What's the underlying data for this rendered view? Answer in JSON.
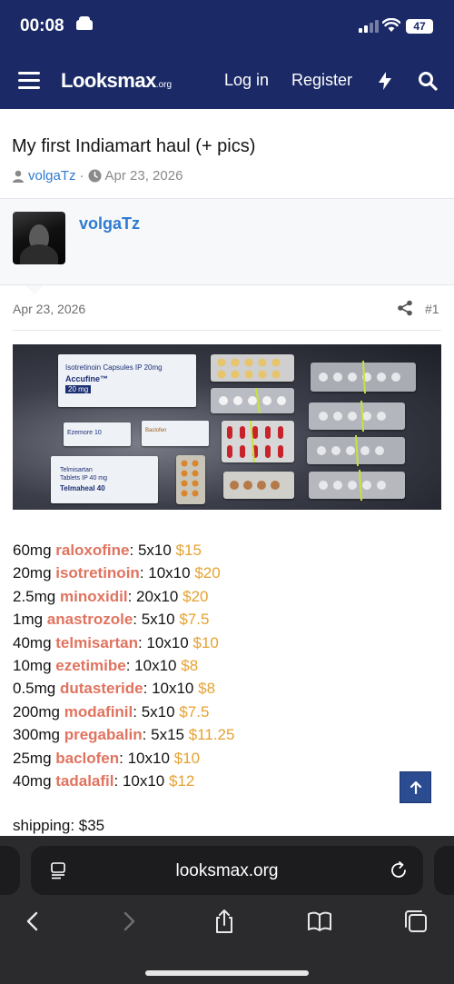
{
  "status_bar": {
    "time": "00:08",
    "battery": "47"
  },
  "navbar": {
    "logo_main": "Looksmax",
    "logo_suffix": ".org",
    "login_label": "Log in",
    "register_label": "Register"
  },
  "thread": {
    "title": "My first Indiamart haul (+ pics)",
    "author": "volgaTz",
    "separator": "·",
    "date": "Apr 23, 2026"
  },
  "post": {
    "author": "volgaTz",
    "date": "Apr 23, 2026",
    "number": "#1",
    "photo_labels": {
      "box1_line1": "Isotretinoin Capsules IP 20mg",
      "box1_line2": "Accufine™",
      "box1_line3": "20 mg",
      "box2": "Telmisartan",
      "box2_line2": "Tablets IP 40 mg",
      "box2_line3": "Telmaheal 40",
      "box3": "Ezemore 10",
      "box4": "Baclofen"
    },
    "items": [
      {
        "dose": "60mg ",
        "drug": "raloxofine",
        "qty": ": 5x10 ",
        "price": "$15"
      },
      {
        "dose": "20mg ",
        "drug": "isotretinoin",
        "qty": ": 10x10 ",
        "price": "$20"
      },
      {
        "dose": "2.5mg ",
        "drug": "minoxidil",
        "qty": ": 20x10 ",
        "price": "$20"
      },
      {
        "dose": "1mg ",
        "drug": "anastrozole",
        "qty": ": 5x10 ",
        "price": "$7.5"
      },
      {
        "dose": "40mg ",
        "drug": "telmisartan",
        "qty": ": 10x10 ",
        "price": "$10"
      },
      {
        "dose": "10mg ",
        "drug": "ezetimibe",
        "qty": ": 10x10 ",
        "price": "$8"
      },
      {
        "dose": "0.5mg ",
        "drug": "dutasteride",
        "qty": ": 10x10 ",
        "price": "$8"
      },
      {
        "dose": "200mg ",
        "drug": "modafinil",
        "qty": ": 5x10 ",
        "price": "$7.5"
      },
      {
        "dose": "300mg ",
        "drug": "pregabalin",
        "qty": ": 5x15 ",
        "price": "$11.25"
      },
      {
        "dose": "25mg ",
        "drug": "baclofen",
        "qty": ": 10x10 ",
        "price": "$10"
      },
      {
        "dose": "40mg ",
        "drug": "tadalafil",
        "qty": ": 10x10 ",
        "price": "$12"
      }
    ],
    "shipping": "shipping: $35"
  },
  "browser": {
    "url": "looksmax.org"
  },
  "colors": {
    "nav_bg": "#1b2a66",
    "link": "#2f7bd0",
    "drug": "#e0735f",
    "price": "#e5a232"
  }
}
